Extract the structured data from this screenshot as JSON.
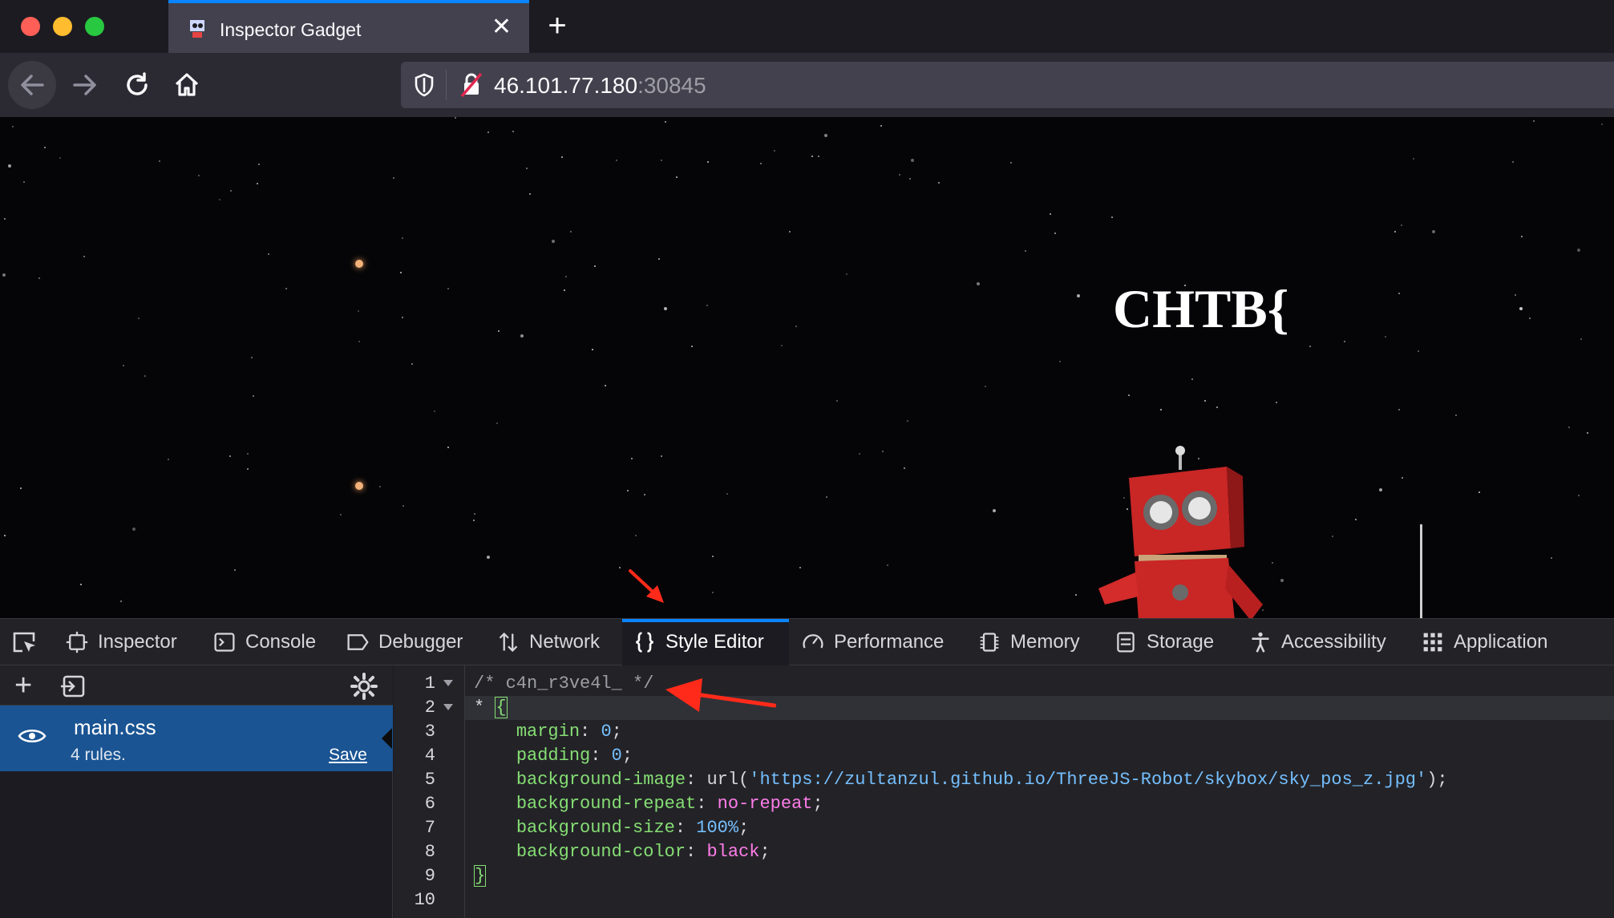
{
  "browser": {
    "tab_title": "Inspector Gadget",
    "url_host": "46.101.77.180",
    "url_port": ":30845"
  },
  "page": {
    "flag_text": "CHTB{"
  },
  "devtools": {
    "tabs": [
      {
        "label": "Inspector",
        "icon": "inspector-icon"
      },
      {
        "label": "Console",
        "icon": "console-icon"
      },
      {
        "label": "Debugger",
        "icon": "debugger-icon"
      },
      {
        "label": "Network",
        "icon": "network-icon"
      },
      {
        "label": "Style Editor",
        "icon": "style-editor-icon",
        "selected": true
      },
      {
        "label": "Performance",
        "icon": "performance-icon"
      },
      {
        "label": "Memory",
        "icon": "memory-icon"
      },
      {
        "label": "Storage",
        "icon": "storage-icon"
      },
      {
        "label": "Accessibility",
        "icon": "accessibility-icon"
      },
      {
        "label": "Application",
        "icon": "application-icon"
      }
    ],
    "stylesheet": {
      "name": "main.css",
      "rules": "4 rules.",
      "save_label": "Save"
    },
    "code": {
      "line_numbers": [
        "1",
        "2",
        "3",
        "4",
        "5",
        "6",
        "7",
        "8",
        "9",
        "10"
      ],
      "comment": "/* c4n_r3ve4l_ */",
      "selector": "* ",
      "open_brace": "{",
      "close_brace": "}",
      "declarations": [
        {
          "prop": "margin",
          "value": "0"
        },
        {
          "prop": "padding",
          "value": "0"
        },
        {
          "prop": "background-image",
          "value_prefix": "url(",
          "value": "'https://zultanzul.github.io/ThreeJS-Robot/skybox/sky_pos_z.jpg'",
          "value_suffix": ");"
        },
        {
          "prop": "background-repeat",
          "value": "no-repeat"
        },
        {
          "prop": "background-size",
          "value": "100%"
        },
        {
          "prop": "background-color",
          "value": "black"
        }
      ]
    }
  },
  "colors": {
    "accent": "#0a84ff",
    "selected_sheet": "#1a5493",
    "annotation_arrow": "#ff2a1a",
    "robot_red": "#d42b2b"
  }
}
